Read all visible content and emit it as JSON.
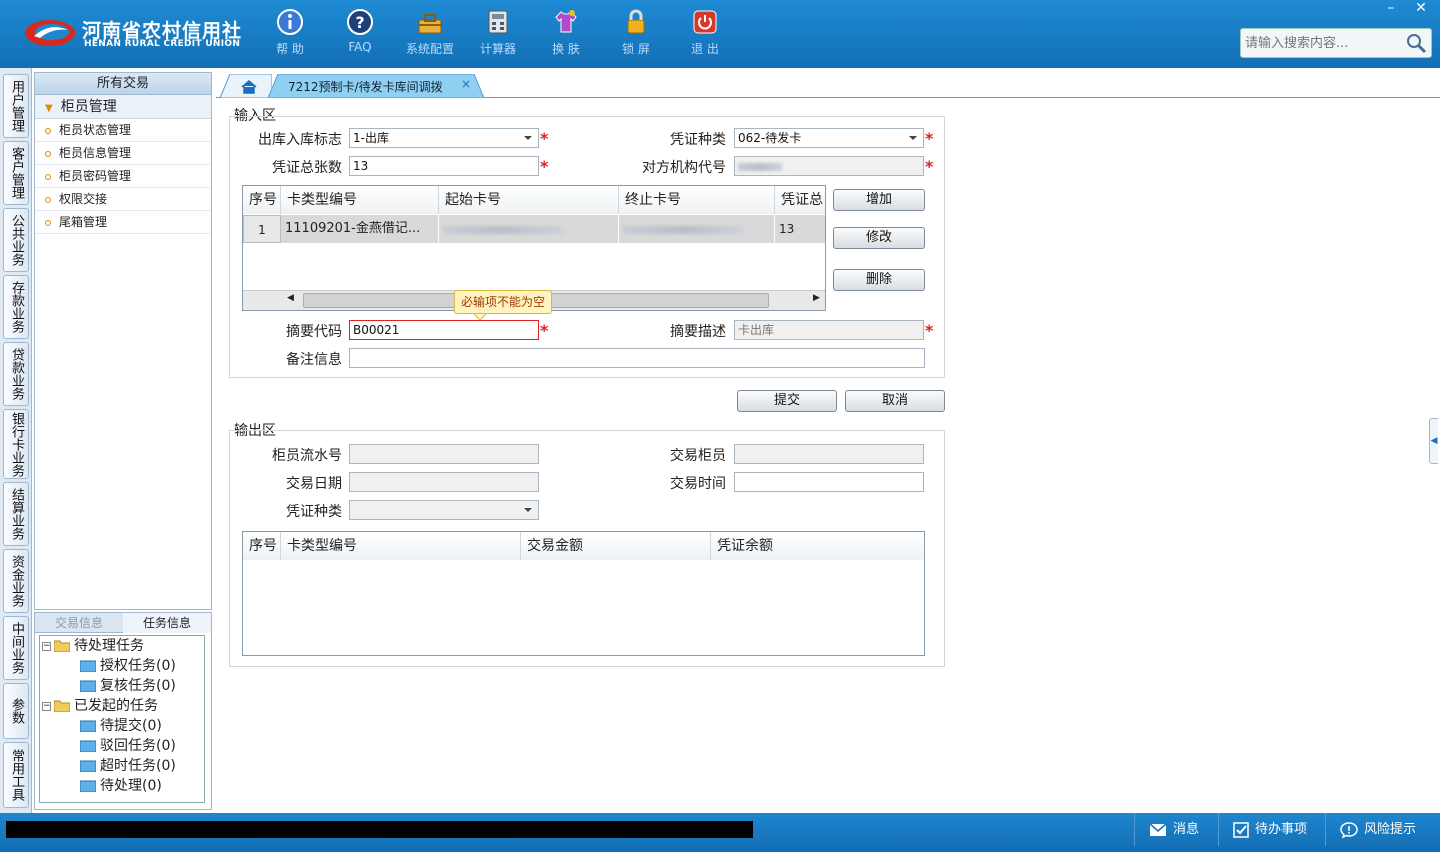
{
  "app": {
    "logo_cn": "河南省农村信用社",
    "logo_en": "HENAN RURAL CREDIT UNION",
    "minimize": "–",
    "close": "✕"
  },
  "toolbar": [
    {
      "label": "帮 助",
      "icon": "info-icon"
    },
    {
      "label": "FAQ",
      "icon": "question-icon"
    },
    {
      "label": "系统配置",
      "icon": "toolbox-icon"
    },
    {
      "label": "计算器",
      "icon": "calculator-icon"
    },
    {
      "label": "换 肤",
      "icon": "shirt-icon"
    },
    {
      "label": "锁 屏",
      "icon": "lock-icon"
    },
    {
      "label": "退 出",
      "icon": "power-icon"
    }
  ],
  "search": {
    "placeholder": "请输入搜索内容..."
  },
  "vtabs": [
    "用户管理",
    "客户管理",
    "公共业务",
    "存款业务",
    "贷款业务",
    "银行卡业务",
    "结算业务",
    "资金业务",
    "中间业务",
    "参数",
    "常用工具"
  ],
  "sidebar": {
    "header": "所有交易",
    "group": "柜员管理",
    "items": [
      "柜员状态管理",
      "柜员信息管理",
      "柜员密码管理",
      "权限交接",
      "尾箱管理"
    ]
  },
  "taskpanel": {
    "tabs": [
      "交易信息",
      "任务信息"
    ],
    "tree": [
      {
        "label": "待处理任务",
        "level": 0
      },
      {
        "label": "授权任务(0)",
        "level": 1
      },
      {
        "label": "复核任务(0)",
        "level": 1
      },
      {
        "label": "已发起的任务",
        "level": 0
      },
      {
        "label": "待提交(0)",
        "level": 1
      },
      {
        "label": "驳回任务(0)",
        "level": 1
      },
      {
        "label": "超时任务(0)",
        "level": 1
      },
      {
        "label": "待处理(0)",
        "level": 1
      }
    ]
  },
  "tabs": {
    "current": "7212预制卡/待发卡库间调拨",
    "close": "×"
  },
  "input_area": {
    "title": "输入区",
    "in_out_flag": {
      "label": "出库入库标志",
      "value": "1-出库"
    },
    "voucher_type": {
      "label": "凭证种类",
      "value": "062-待发卡"
    },
    "voucher_count": {
      "label": "凭证总张数",
      "value": "13"
    },
    "counterpart_org": {
      "label": "对方机构代号",
      "value": ""
    },
    "grid_headers": [
      "序号",
      "卡类型编号",
      "起始卡号",
      "终止卡号",
      "凭证总"
    ],
    "grid_rows": [
      {
        "no": "1",
        "card_type": "11109201-金燕借记...",
        "start": "",
        "end": "",
        "total": "13"
      }
    ],
    "buttons": {
      "add": "增加",
      "modify": "修改",
      "delete": "删除"
    },
    "summary_code": {
      "label": "摘要代码",
      "value": "B00021"
    },
    "summary_desc": {
      "label": "摘要描述",
      "value": "卡出库"
    },
    "remark": {
      "label": "备注信息",
      "value": ""
    },
    "tooltip": "必输项不能为空",
    "req": "*"
  },
  "actions": {
    "submit": "提交",
    "cancel": "取消"
  },
  "output_area": {
    "title": "输出区",
    "teller_serial": {
      "label": "柜员流水号",
      "value": ""
    },
    "trade_teller": {
      "label": "交易柜员",
      "value": ""
    },
    "trade_date": {
      "label": "交易日期",
      "value": ""
    },
    "trade_time": {
      "label": "交易时间",
      "value": ""
    },
    "voucher_type": {
      "label": "凭证种类",
      "value": ""
    },
    "grid_headers": [
      "序号",
      "卡类型编号",
      "交易金额",
      "凭证余额"
    ]
  },
  "statusbar": {
    "message": "消息",
    "todo": "待办事项",
    "risk": "风险提示"
  }
}
